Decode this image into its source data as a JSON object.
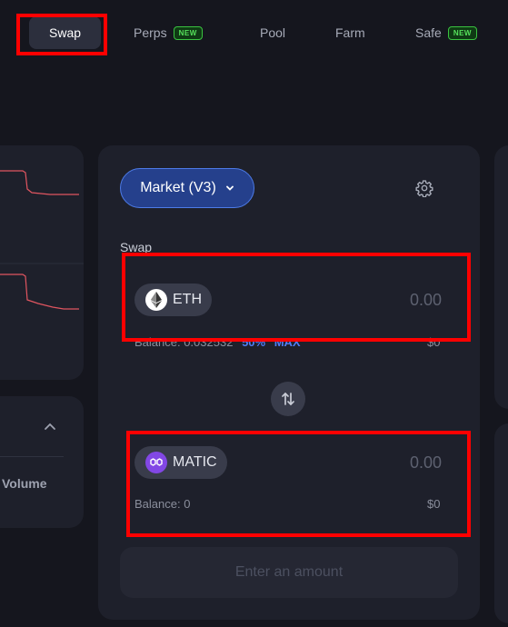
{
  "nav": {
    "tabs": [
      {
        "label": "Swap",
        "active": true
      },
      {
        "label": "Perps",
        "badge": "NEW"
      },
      {
        "label": "Pool"
      },
      {
        "label": "Farm"
      },
      {
        "label": "Safe",
        "badge": "NEW"
      }
    ]
  },
  "stats": {
    "volume_label": "Volume"
  },
  "swap": {
    "market_label": "Market (V3)",
    "section_label": "Swap",
    "from": {
      "token": "ETH",
      "amount_placeholder": "0.00",
      "balance": "Balance: 0.032532",
      "percent": "50%",
      "max": "MAX",
      "usd": "$0"
    },
    "to": {
      "token": "MATIC",
      "amount_placeholder": "0.00",
      "balance": "Balance: 0",
      "usd": "$0"
    },
    "cta": "Enter an amount"
  },
  "icons": {
    "settings": "gear-icon",
    "switch": "arrows-up-down-icon",
    "dropdown": "chevron-down-icon",
    "collapse": "chevron-up-icon"
  },
  "colors": {
    "background": "#15161e",
    "panel": "#1e202b",
    "accent": "#4f7cf5",
    "badge_green": "#57e05c",
    "chart_line": "#e05560",
    "highlight": "#ff0000"
  }
}
